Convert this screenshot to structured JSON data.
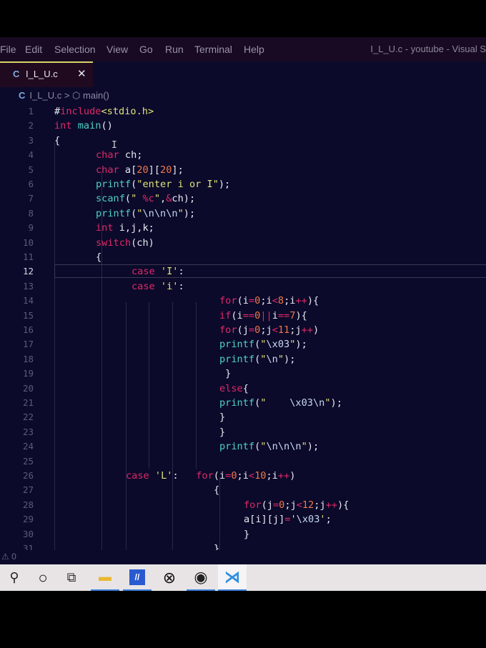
{
  "menu": [
    "File",
    "Edit",
    "Selection",
    "View",
    "Go",
    "Run",
    "Terminal",
    "Help"
  ],
  "window_title": "I_L_U.c - youtube - Visual S",
  "tab": {
    "icon": "C",
    "name": "I_L_U.c",
    "close": "✕"
  },
  "breadcrumb": {
    "icon": "C",
    "file": "I_L_U.c",
    "sep": ">",
    "symbol_icon": "⬡",
    "symbol": "main()"
  },
  "current_line": 12,
  "code": [
    {
      "n": "1",
      "t": [
        [
          "#",
          "p"
        ],
        [
          "include",
          "k"
        ],
        [
          "<stdio.h>",
          "s"
        ]
      ]
    },
    {
      "n": "2",
      "t": [
        [
          "int ",
          "k"
        ],
        [
          "main",
          "f"
        ],
        [
          "()",
          "p"
        ]
      ]
    },
    {
      "n": "3",
      "t": [
        [
          "{",
          "p"
        ]
      ]
    },
    {
      "n": "4",
      "t": [
        [
          "char ",
          "k"
        ],
        [
          "ch;",
          "p"
        ]
      ]
    },
    {
      "n": "5",
      "t": [
        [
          "char ",
          "k"
        ],
        [
          "a[",
          "p"
        ],
        [
          "20",
          "n"
        ],
        [
          "][",
          "p"
        ],
        [
          "20",
          "n"
        ],
        [
          "];",
          "p"
        ]
      ]
    },
    {
      "n": "6",
      "t": [
        [
          "printf",
          "f"
        ],
        [
          "(",
          "p"
        ],
        [
          "\"enter i or I\"",
          "s"
        ],
        [
          ");",
          "p"
        ]
      ]
    },
    {
      "n": "7",
      "t": [
        [
          "scanf",
          "f"
        ],
        [
          "(",
          "p"
        ],
        [
          "\" ",
          "s"
        ],
        [
          "%c",
          "k"
        ],
        [
          "\"",
          "s"
        ],
        [
          ",",
          "p"
        ],
        [
          "&",
          "o"
        ],
        [
          "ch);",
          "p"
        ]
      ]
    },
    {
      "n": "8",
      "t": [
        [
          "printf",
          "f"
        ],
        [
          "(",
          "p"
        ],
        [
          "\"",
          "s"
        ],
        [
          "\\n\\n\\n",
          "e"
        ],
        [
          "\"",
          "s"
        ],
        [
          ");",
          "p"
        ]
      ]
    },
    {
      "n": "9",
      "t": [
        [
          "int ",
          "k"
        ],
        [
          "i,j,k;",
          "p"
        ]
      ]
    },
    {
      "n": "10",
      "t": [
        [
          "switch",
          "k"
        ],
        [
          "(ch)",
          "p"
        ]
      ]
    },
    {
      "n": "11",
      "t": [
        [
          "{",
          "p"
        ]
      ]
    },
    {
      "n": "12",
      "t": [
        [
          "case ",
          "k"
        ],
        [
          "'I'",
          "s"
        ],
        [
          ":",
          "p"
        ]
      ]
    },
    {
      "n": "13",
      "t": [
        [
          "case ",
          "k"
        ],
        [
          "'i'",
          "s"
        ],
        [
          ":",
          "p"
        ]
      ]
    },
    {
      "n": "14",
      "t": [
        [
          "for",
          "k"
        ],
        [
          "(i",
          "p"
        ],
        [
          "=",
          "o"
        ],
        [
          "0",
          "n"
        ],
        [
          ";i",
          "p"
        ],
        [
          "<",
          "o"
        ],
        [
          "8",
          "n"
        ],
        [
          ";i",
          "p"
        ],
        [
          "++",
          "o"
        ],
        [
          "){",
          "p"
        ]
      ]
    },
    {
      "n": "15",
      "t": [
        [
          "if",
          "k"
        ],
        [
          "(i",
          "p"
        ],
        [
          "==",
          "o"
        ],
        [
          "0",
          "n"
        ],
        [
          "||",
          "o"
        ],
        [
          "i",
          "p"
        ],
        [
          "==",
          "o"
        ],
        [
          "7",
          "n"
        ],
        [
          "){",
          "p"
        ]
      ]
    },
    {
      "n": "16",
      "t": [
        [
          "for",
          "k"
        ],
        [
          "(j",
          "p"
        ],
        [
          "=",
          "o"
        ],
        [
          "0",
          "n"
        ],
        [
          ";j",
          "p"
        ],
        [
          "<",
          "o"
        ],
        [
          "11",
          "n"
        ],
        [
          ";j",
          "p"
        ],
        [
          "++",
          "o"
        ],
        [
          ")",
          "p"
        ]
      ]
    },
    {
      "n": "17",
      "t": [
        [
          "printf",
          "f"
        ],
        [
          "(",
          "p"
        ],
        [
          "\"",
          "s"
        ],
        [
          "\\x03",
          "e"
        ],
        [
          "\"",
          "s"
        ],
        [
          ");",
          "p"
        ]
      ]
    },
    {
      "n": "18",
      "t": [
        [
          "printf",
          "f"
        ],
        [
          "(",
          "p"
        ],
        [
          "\"",
          "s"
        ],
        [
          "\\n",
          "e"
        ],
        [
          "\"",
          "s"
        ],
        [
          ");",
          "p"
        ]
      ]
    },
    {
      "n": "19",
      "t": [
        [
          " }",
          "p"
        ]
      ]
    },
    {
      "n": "20",
      "t": [
        [
          "else",
          "k"
        ],
        [
          "{",
          "p"
        ]
      ]
    },
    {
      "n": "21",
      "t": [
        [
          "printf",
          "f"
        ],
        [
          "(",
          "p"
        ],
        [
          "\"    ",
          "s"
        ],
        [
          "\\x03\\n",
          "e"
        ],
        [
          "\"",
          "s"
        ],
        [
          ");",
          "p"
        ]
      ]
    },
    {
      "n": "22",
      "t": [
        [
          "}",
          "p"
        ]
      ]
    },
    {
      "n": "23",
      "t": [
        [
          "}",
          "p"
        ]
      ]
    },
    {
      "n": "24",
      "t": [
        [
          "printf",
          "f"
        ],
        [
          "(",
          "p"
        ],
        [
          "\"",
          "s"
        ],
        [
          "\\n\\n\\n",
          "e"
        ],
        [
          "\"",
          "s"
        ],
        [
          ");",
          "p"
        ]
      ]
    },
    {
      "n": "25",
      "t": []
    },
    {
      "n": "26",
      "t": [
        [
          "case ",
          "k"
        ],
        [
          "'L'",
          "s"
        ],
        [
          ":   ",
          "p"
        ],
        [
          "for",
          "k"
        ],
        [
          "(i",
          "p"
        ],
        [
          "=",
          "o"
        ],
        [
          "0",
          "n"
        ],
        [
          ";i",
          "p"
        ],
        [
          "<",
          "o"
        ],
        [
          "10",
          "n"
        ],
        [
          ";i",
          "p"
        ],
        [
          "++",
          "o"
        ],
        [
          ")",
          "p"
        ]
      ]
    },
    {
      "n": "27",
      "t": [
        [
          "{",
          "p"
        ]
      ]
    },
    {
      "n": "28",
      "t": [
        [
          "for",
          "k"
        ],
        [
          "(j",
          "p"
        ],
        [
          "=",
          "o"
        ],
        [
          "0",
          "n"
        ],
        [
          ";j",
          "p"
        ],
        [
          "<",
          "o"
        ],
        [
          "12",
          "n"
        ],
        [
          ";j",
          "p"
        ],
        [
          "++",
          "o"
        ],
        [
          "){",
          "p"
        ]
      ]
    },
    {
      "n": "29",
      "t": [
        [
          "a[i][j]",
          "p"
        ],
        [
          "=",
          "o"
        ],
        [
          "'",
          "s"
        ],
        [
          "\\x03",
          "e"
        ],
        [
          "'",
          "s"
        ],
        [
          ";",
          "p"
        ]
      ]
    },
    {
      "n": "30",
      "t": [
        [
          "}",
          "p"
        ]
      ]
    },
    {
      "n": "31",
      "t": [
        [
          "}",
          "p"
        ]
      ]
    }
  ],
  "status": {
    "warnings_icon": "⚠",
    "warnings": "0"
  },
  "taskbar": [
    {
      "name": "search",
      "glyph": "⚲"
    },
    {
      "name": "cortana",
      "glyph": "○"
    },
    {
      "name": "task-view",
      "glyph": "⧉"
    },
    {
      "name": "file-explorer",
      "glyph": "▬"
    },
    {
      "name": "app-blue",
      "glyph": "//"
    },
    {
      "name": "xbox",
      "glyph": "⊗"
    },
    {
      "name": "obs",
      "glyph": "◉"
    },
    {
      "name": "vscode",
      "glyph": "⋊"
    }
  ],
  "colors": {
    "keyword": "#e0286a",
    "function": "#4fd0c6",
    "string": "#dfe27a",
    "number": "#f0784a",
    "background": "#0b0a2a",
    "accent": "#3b7dd8"
  }
}
